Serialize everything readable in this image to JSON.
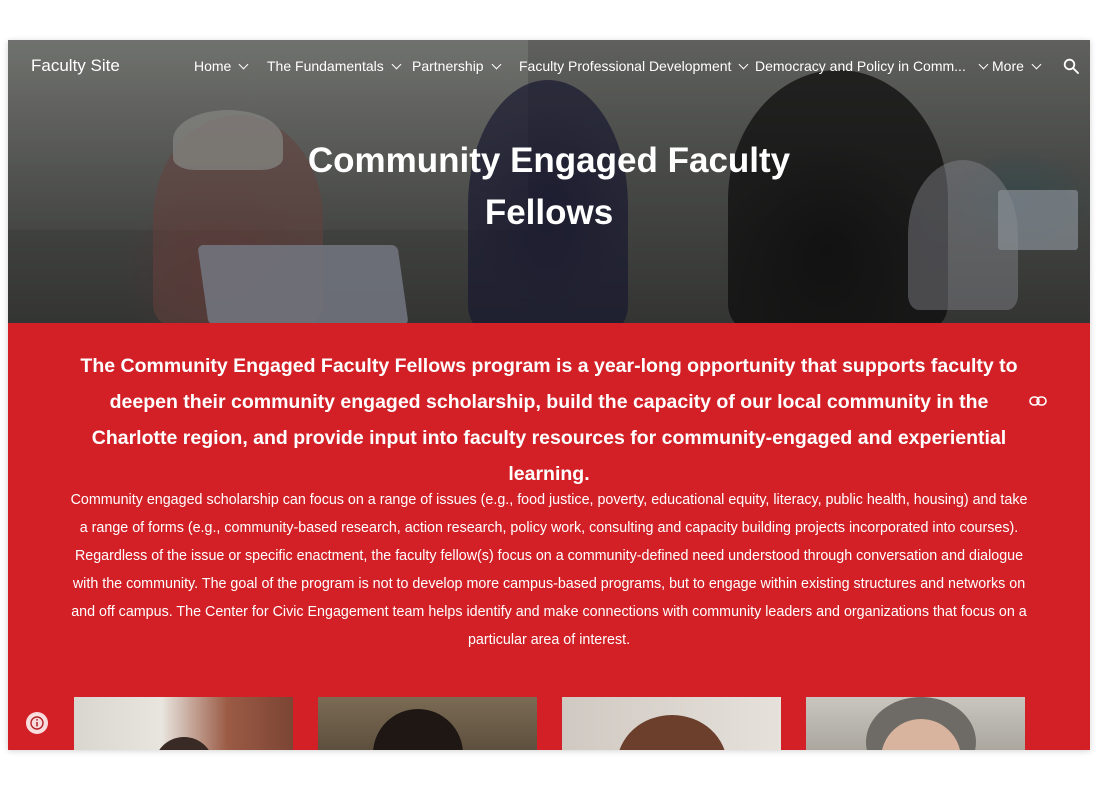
{
  "nav": {
    "site_title": "Faculty Site",
    "items": [
      {
        "label": "Home"
      },
      {
        "label": "The Fundamentals"
      },
      {
        "label": "Partnership"
      },
      {
        "label": "Faculty Professional Development"
      },
      {
        "label": "Democracy and Policy in Comm..."
      },
      {
        "label": "More"
      }
    ],
    "search_icon": "search-icon"
  },
  "hero": {
    "title_line1": "Community Engaged Faculty",
    "title_line2": "Fellows"
  },
  "content": {
    "lead": "The Community Engaged Faculty Fellows program is a year-long opportunity that supports faculty to deepen their community engaged scholarship, build the capacity of our local community in the Charlotte region, and provide input into faculty resources for community-engaged and experiential learning.",
    "body": "Community engaged scholarship can focus on a range of issues (e.g., food justice, poverty, educational equity, literacy, public health, housing) and take a range of forms (e.g., community-based research, action research, policy work, consulting and capacity building projects incorporated into courses).  Regardless of the issue or specific enactment, the faculty fellow(s) focus on a community-defined need understood through conversation and dialogue with the community.  The goal of the program is not to develop more campus-based programs, but to engage within existing structures and networks on and off campus. The Center for Civic Engagement team helps identify and make connections with community leaders and organizations that focus on a particular area of interest."
  },
  "colors": {
    "accent_red": "#d32027",
    "text": "#ffffff"
  },
  "icons": [
    "search-icon",
    "chevron-down-icon",
    "link-icon",
    "info-icon"
  ]
}
